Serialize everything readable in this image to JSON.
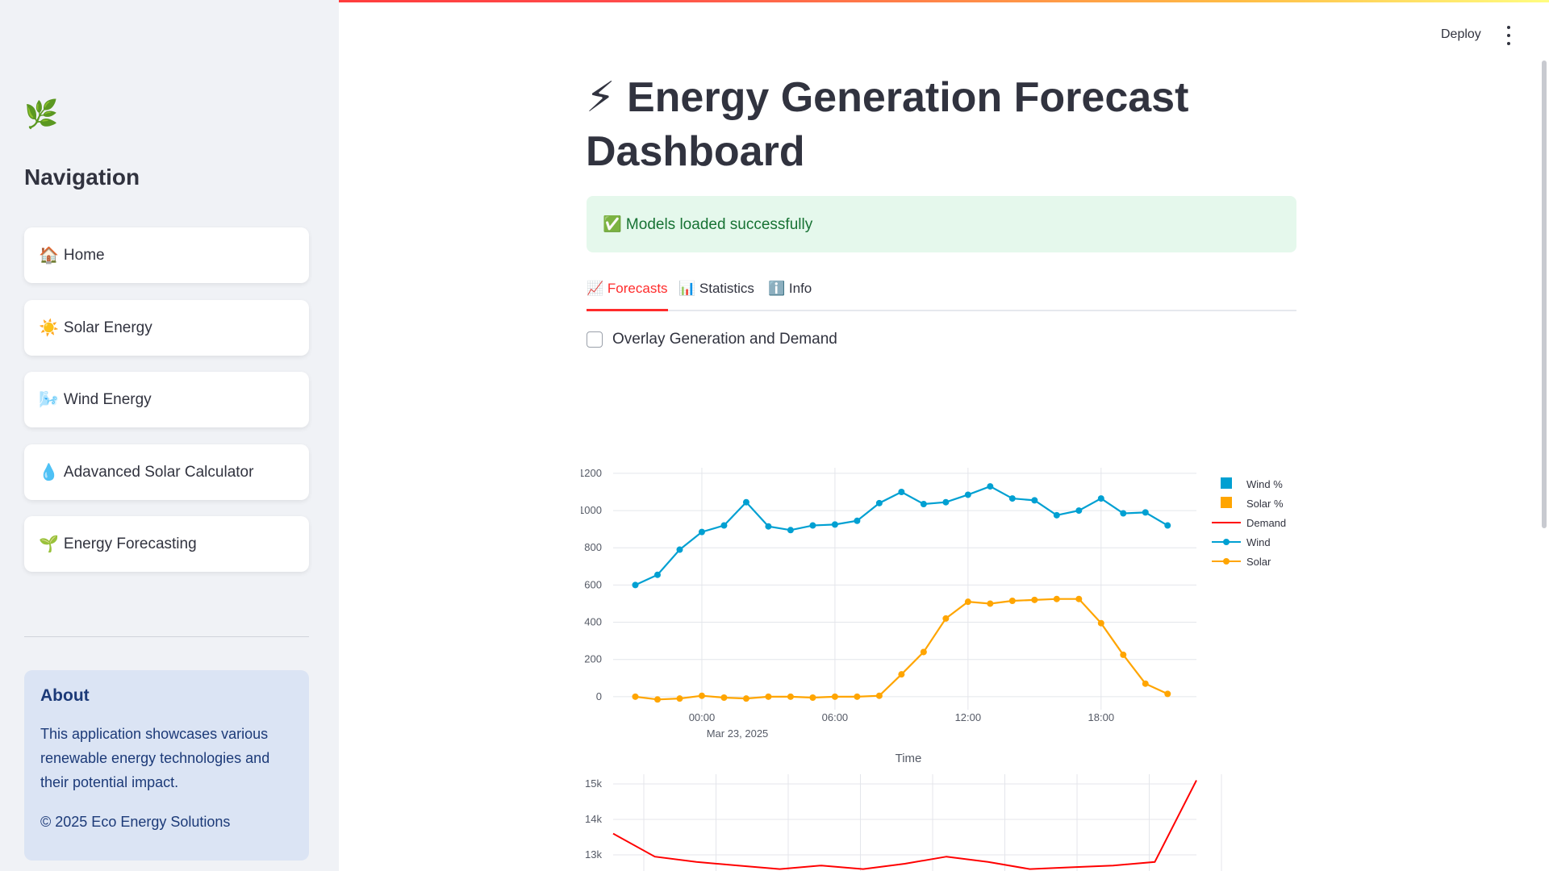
{
  "sidebar": {
    "logo_icon": "🌿",
    "nav_title": "Navigation",
    "items": [
      {
        "icon": "🏠",
        "label": "Home"
      },
      {
        "icon": "☀️",
        "label": "Solar Energy"
      },
      {
        "icon": "🌬️",
        "label": "Wind Energy"
      },
      {
        "icon": "💧",
        "label": "Adavanced Solar Calculator"
      },
      {
        "icon": "🌱",
        "label": "Energy Forecasting"
      }
    ],
    "about": {
      "title": "About",
      "text": "This application showcases various renewable energy technologies and their potential impact.",
      "copyright": "© 2025 Eco Energy Solutions"
    }
  },
  "header": {
    "deploy_label": "Deploy"
  },
  "main": {
    "title_icon": "⚡",
    "title": "Energy Generation Forecast Dashboard",
    "success_message": "✅ Models loaded successfully",
    "tabs": [
      {
        "icon": "📈",
        "label": "Forecasts",
        "active": true
      },
      {
        "icon": "📊",
        "label": "Statistics",
        "active": false
      },
      {
        "icon": "ℹ️",
        "label": "Info",
        "active": false
      }
    ],
    "checkbox_label": "Overlay Generation and Demand"
  },
  "chart_data": [
    {
      "type": "line",
      "xlabel": "Time",
      "x_ticks": [
        "00:00",
        "06:00",
        "12:00",
        "18:00"
      ],
      "x_date_label": "Mar 23, 2025",
      "y_ticks": [
        0,
        200,
        400,
        600,
        800,
        1000,
        1200
      ],
      "ylim": [
        -70,
        1230
      ],
      "x": [
        "Mar 22, 2025 21:00",
        "22:00",
        "23:00",
        "00:00",
        "01:00",
        "02:00",
        "03:00",
        "04:00",
        "05:00",
        "06:00",
        "07:00",
        "08:00",
        "09:00",
        "10:00",
        "11:00",
        "12:00",
        "13:00",
        "14:00",
        "15:00",
        "16:00",
        "17:00",
        "18:00",
        "19:00",
        "20:00",
        "21:00",
        "22:00"
      ],
      "xlim_hours": [
        -4,
        22.3
      ],
      "legend": [
        "Wind %",
        "Solar %",
        "Demand",
        "Wind",
        "Solar"
      ],
      "legend_colors": [
        "#00a0d2",
        "#ffa500",
        "#ff0000",
        "#00a0d2",
        "#ffa500"
      ],
      "legend_placement": "right",
      "grid": true,
      "series": [
        {
          "name": "Wind",
          "color": "#00a0d2",
          "values": [
            600,
            655,
            790,
            885,
            920,
            1045,
            915,
            895,
            920,
            925,
            945,
            1040,
            1100,
            1035,
            1045,
            1085,
            1130,
            1065,
            1055,
            975,
            1000,
            1065,
            985,
            990,
            920
          ]
        },
        {
          "name": "Solar",
          "color": "#ffa500",
          "values": [
            0,
            -15,
            -10,
            5,
            -5,
            -10,
            0,
            0,
            -5,
            0,
            0,
            5,
            120,
            240,
            420,
            510,
            500,
            515,
            520,
            525,
            525,
            395,
            225,
            70,
            15
          ]
        }
      ]
    },
    {
      "type": "line",
      "y_ticks": [
        "13k",
        "14k",
        "15k"
      ],
      "series": [
        {
          "name": "Demand",
          "color": "#ff0000",
          "values": [
            13600,
            12950,
            12800,
            12700,
            12600,
            12700,
            12600,
            12750,
            12950,
            12800,
            12600,
            12650,
            12700,
            12800,
            15100
          ]
        }
      ]
    }
  ]
}
